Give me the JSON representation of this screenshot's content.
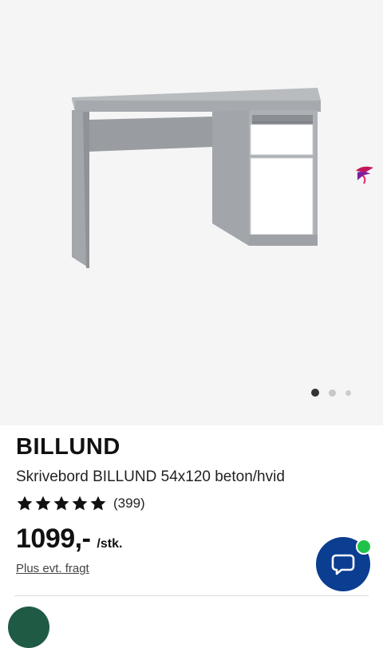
{
  "product": {
    "brand": "BILLUND",
    "title": "Skrivebord BILLUND 54x120 beton/hvid",
    "rating": {
      "stars": 5,
      "max_stars": 5,
      "count_label": "(399)"
    },
    "price": "1099,-",
    "unit": "/stk.",
    "shipping_link": "Plus evt. fragt"
  },
  "gallery": {
    "image": "desk-image",
    "slides": 3,
    "active_slide": 1
  },
  "chat": {
    "icon": "chat-bubble-icon",
    "status_color": "#1fc24a",
    "button_color": "#0b3d91"
  }
}
